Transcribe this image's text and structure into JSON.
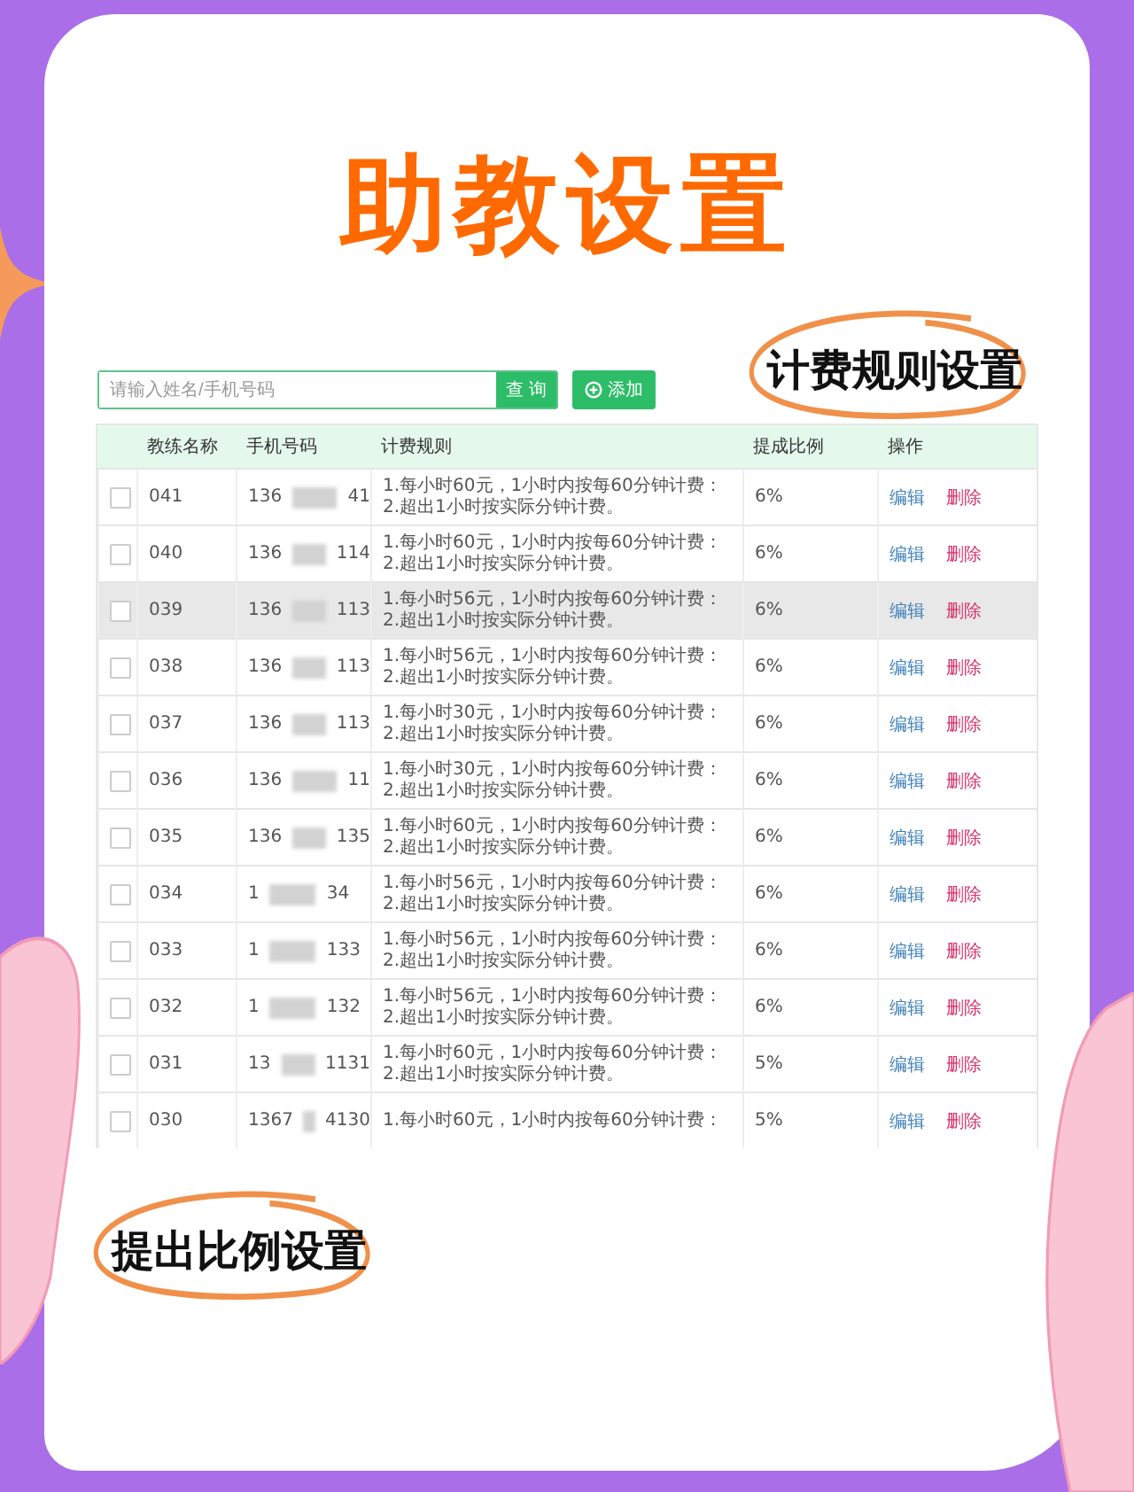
{
  "title": "助教设置",
  "search": {
    "placeholder": "请输入姓名/手机号码",
    "button": "查 询"
  },
  "add_button": "添加",
  "callout_top": "计费规则设置",
  "table": {
    "columns": [
      "教练名称",
      "手机号码",
      "计费规则",
      "提成比例",
      "操作"
    ],
    "rows": [
      {
        "name": "041",
        "phone_start": "136",
        "phone_end": "41",
        "rule_lines": [
          "1.每小时60元，1小时内按每60分钟计费：",
          "2.超出1小时按实际分钟计费。"
        ],
        "ratio": "6%",
        "actions": [
          "编辑",
          "删除"
        ],
        "checked": false,
        "hovered": false
      },
      {
        "name": "040",
        "phone_start": "136",
        "phone_end": "114",
        "rule_lines": [
          "1.每小时60元，1小时内按每60分钟计费：",
          "2.超出1小时按实际分钟计费。"
        ],
        "ratio": "6%",
        "actions": [
          "编辑",
          "删除"
        ],
        "checked": false,
        "hovered": false
      },
      {
        "name": "039",
        "phone_start": "136",
        "phone_end": "113",
        "rule_lines": [
          "1.每小时56元，1小时内按每60分钟计费：",
          "2.超出1小时按实际分钟计费。"
        ],
        "ratio": "6%",
        "actions": [
          "编辑",
          "删除"
        ],
        "checked": false,
        "hovered": true
      },
      {
        "name": "038",
        "phone_start": "136",
        "phone_end": "113",
        "rule_lines": [
          "1.每小时56元，1小时内按每60分钟计费：",
          "2.超出1小时按实际分钟计费。"
        ],
        "ratio": "6%",
        "actions": [
          "编辑",
          "删除"
        ],
        "checked": false,
        "hovered": false
      },
      {
        "name": "037",
        "phone_start": "136",
        "phone_end": "113",
        "rule_lines": [
          "1.每小时30元，1小时内按每60分钟计费：",
          "2.超出1小时按实际分钟计费。"
        ],
        "ratio": "6%",
        "actions": [
          "编辑",
          "删除"
        ],
        "checked": false,
        "hovered": false
      },
      {
        "name": "036",
        "phone_start": "136",
        "phone_end": "11",
        "rule_lines": [
          "1.每小时30元，1小时内按每60分钟计费：",
          "2.超出1小时按实际分钟计费。"
        ],
        "ratio": "6%",
        "actions": [
          "编辑",
          "删除"
        ],
        "checked": false,
        "hovered": false
      },
      {
        "name": "035",
        "phone_start": "136",
        "phone_end": "135",
        "rule_lines": [
          "1.每小时60元，1小时内按每60分钟计费：",
          "2.超出1小时按实际分钟计费。"
        ],
        "ratio": "6%",
        "actions": [
          "编辑",
          "删除"
        ],
        "checked": false,
        "hovered": false
      },
      {
        "name": "034",
        "phone_start": "1",
        "phone_end": "34",
        "rule_lines": [
          "1.每小时56元，1小时内按每60分钟计费：",
          "2.超出1小时按实际分钟计费。"
        ],
        "ratio": "6%",
        "actions": [
          "编辑",
          "删除"
        ],
        "checked": false,
        "hovered": false
      },
      {
        "name": "033",
        "phone_start": "1",
        "phone_end": "133",
        "rule_lines": [
          "1.每小时56元，1小时内按每60分钟计费：",
          "2.超出1小时按实际分钟计费。"
        ],
        "ratio": "6%",
        "actions": [
          "编辑",
          "删除"
        ],
        "checked": false,
        "hovered": false
      },
      {
        "name": "032",
        "phone_start": "1",
        "phone_end": "132",
        "rule_lines": [
          "1.每小时56元，1小时内按每60分钟计费：",
          "2.超出1小时按实际分钟计费。"
        ],
        "ratio": "6%",
        "actions": [
          "编辑",
          "删除"
        ],
        "checked": false,
        "hovered": false
      },
      {
        "name": "031",
        "phone_start": "13",
        "phone_end": "1131",
        "rule_lines": [
          "1.每小时60元，1小时内按每60分钟计费：",
          "2.超出1小时按实际分钟计费。"
        ],
        "ratio": "5%",
        "actions": [
          "编辑",
          "删除"
        ],
        "checked": false,
        "hovered": false
      },
      {
        "name": "030",
        "phone_start": "1367",
        "phone_end": "4130",
        "rule_lines": [
          "1.每小时60元，1小时内按每60分钟计费："
        ],
        "ratio": "5%",
        "actions": [
          "编辑",
          "删除"
        ],
        "checked": false,
        "hovered": false
      }
    ]
  },
  "callout_bottom": "提出比例设置"
}
